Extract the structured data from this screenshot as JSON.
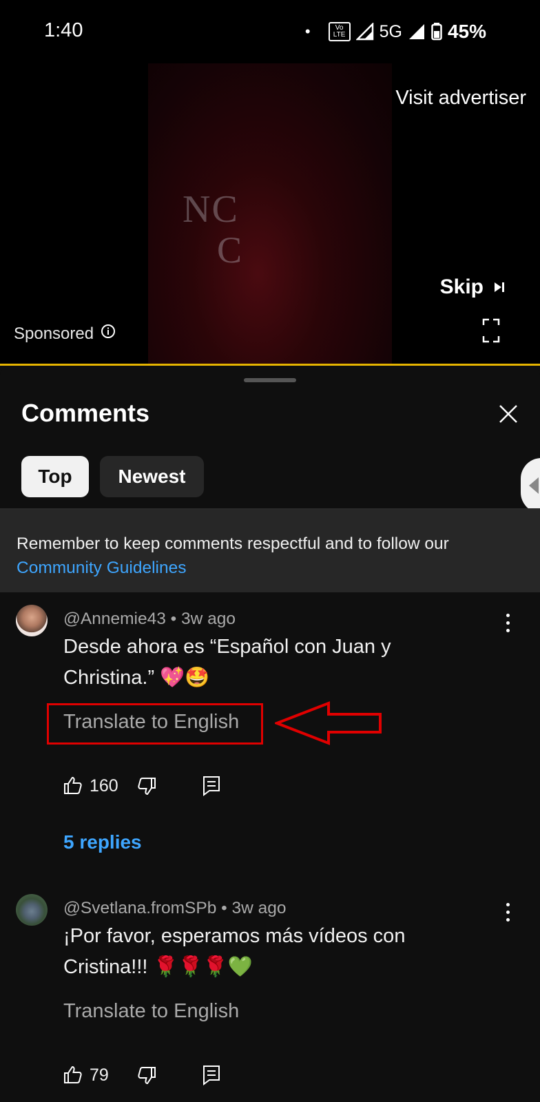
{
  "status_bar": {
    "time": "1:40",
    "dot": "•",
    "network": "5G",
    "volte": "Vo LTE",
    "sim": "2",
    "battery": "45%"
  },
  "ad": {
    "visit_advertiser": "Visit advertiser",
    "skip": "Skip",
    "sponsored": "Sponsored",
    "progress_color": "#e6b400"
  },
  "comments_panel": {
    "title": "Comments",
    "tabs": [
      {
        "label": "Top",
        "selected": true
      },
      {
        "label": "Newest",
        "selected": false
      }
    ],
    "guidelines_text": "Remember to keep comments respectful and to follow our",
    "guidelines_link": "Community Guidelines"
  },
  "comments": [
    {
      "author": "@Annemie43",
      "time": "3w ago",
      "text": "Desde ahora es “Español con Juan y Christina.” 💖🤩",
      "translate": "Translate to English",
      "likes": "160",
      "replies": "5 replies"
    },
    {
      "author": "@Svetlana.fromSPb",
      "time": "3w ago",
      "text": "¡Por favor, esperamos más vídeos con Cristina!!! 🌹🌹🌹💚",
      "translate": "Translate to English",
      "likes": "79"
    }
  ],
  "annotation": {
    "color": "#e00000"
  }
}
